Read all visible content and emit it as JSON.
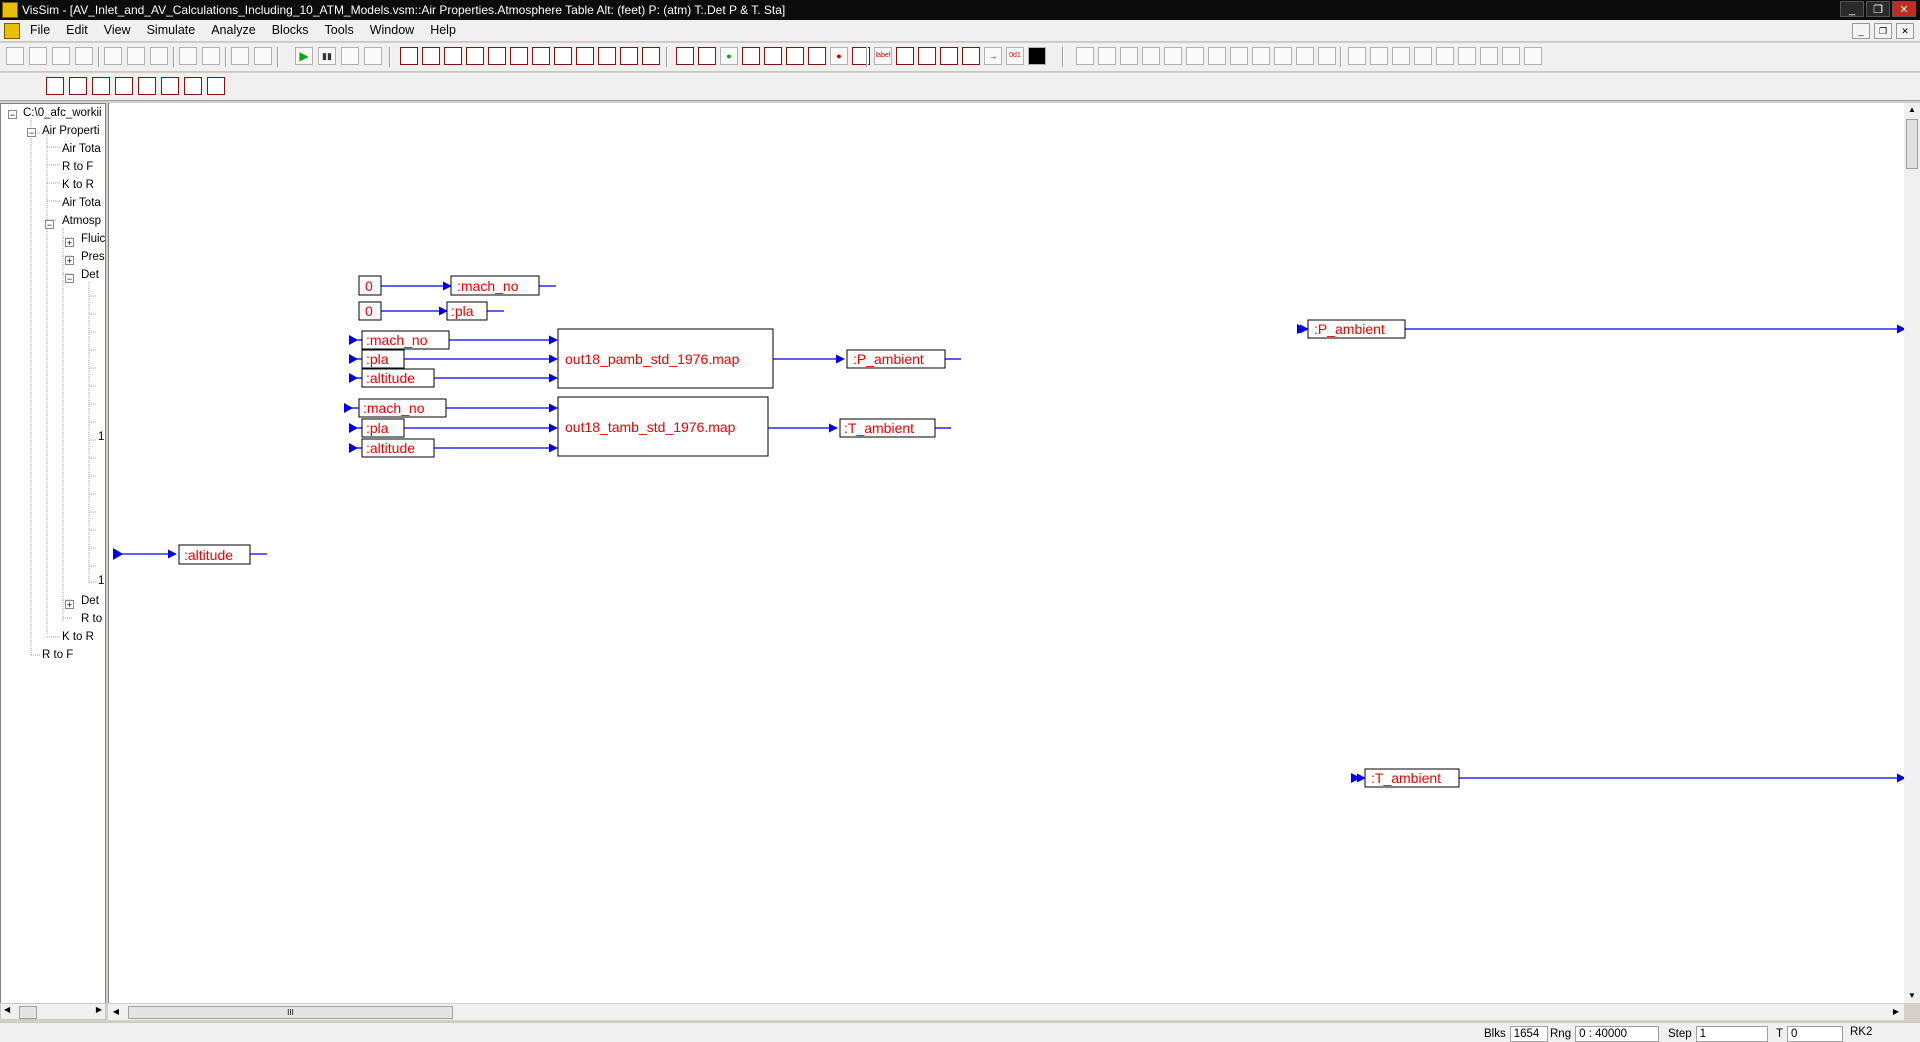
{
  "window": {
    "title": "VisSim - [AV_Inlet_and_AV_Calculations_Including_10_ATM_Models.vsm::Air Properties.Atmosphere Table Alt: (feet) P: (atm) T:.Det P & T. Sta]",
    "minimize": "_",
    "restore": "❐",
    "close": "✕"
  },
  "menubar": {
    "items": [
      "File",
      "Edit",
      "View",
      "Simulate",
      "Analyze",
      "Blocks",
      "Tools",
      "Window",
      "Help"
    ],
    "mdi_minimize": "_",
    "mdi_restore": "❐",
    "mdi_close": "✕"
  },
  "toolbar": {
    "label_tool": "label",
    "scope_tool": "0d1"
  },
  "tree": {
    "nodes": [
      {
        "label": "C:\\0_afc_workii",
        "expander": "−"
      },
      {
        "label": "Air Properti",
        "expander": "−"
      },
      {
        "label": "Air Tota"
      },
      {
        "label": "R to F"
      },
      {
        "label": "K to R"
      },
      {
        "label": "Air Tota"
      },
      {
        "label": "Atmosp",
        "expander": "−"
      },
      {
        "label": "Fluic",
        "expander": "+"
      },
      {
        "label": "Pres",
        "expander": "+"
      },
      {
        "label": "Det",
        "expander": "−"
      },
      {
        "label": "Det",
        "expander": "+"
      },
      {
        "label": "R to"
      },
      {
        "label": "K to R"
      },
      {
        "label": "R to F"
      }
    ],
    "truncated_marks": [
      "1",
      "1"
    ]
  },
  "diagram": {
    "const_mach": {
      "value": "0",
      "var": ":mach_no"
    },
    "const_pla": {
      "value": "0",
      "var": ":pla"
    },
    "pamb_map": {
      "inputs": [
        ":mach_no",
        ":pla",
        ":altitude"
      ],
      "label": "out18_pamb_std_1976.map",
      "output": ":P_ambient"
    },
    "tamb_map": {
      "inputs": [
        ":mach_no",
        ":pla",
        ":altitude"
      ],
      "label": "out18_tamb_std_1976.map",
      "output": ":T_ambient"
    },
    "altitude_input": ":altitude",
    "p_ambient_out": ":P_ambient",
    "t_ambient_out": ":T_ambient",
    "colors": {
      "wire": "#0000ee",
      "label": "#ee0000",
      "box": "#000000"
    }
  },
  "statusbar": {
    "blks_label": "Blks",
    "blks_value": "1654",
    "rng_label": "Rng",
    "rng_value": "0 : 40000",
    "step_label": "Step",
    "step_value": "1",
    "t_label": "T",
    "t_value": "0",
    "method": "RK2"
  },
  "scroll": {
    "thumb_grip": "III"
  }
}
